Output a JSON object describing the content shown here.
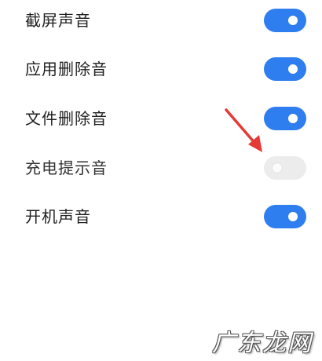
{
  "colors": {
    "toggle_on": "#2f7ef0",
    "toggle_off": "#ececec",
    "arrow": "#e53935",
    "text": "#1f1f1f"
  },
  "settings": [
    {
      "label": "截屏声音",
      "enabled": true
    },
    {
      "label": "应用删除音",
      "enabled": true
    },
    {
      "label": "文件删除音",
      "enabled": true
    },
    {
      "label": "充电提示音",
      "enabled": false
    },
    {
      "label": "开机声音",
      "enabled": true
    }
  ],
  "watermark": {
    "text": "广东龙网"
  },
  "icons": {
    "annotation": "red-arrow-icon"
  }
}
